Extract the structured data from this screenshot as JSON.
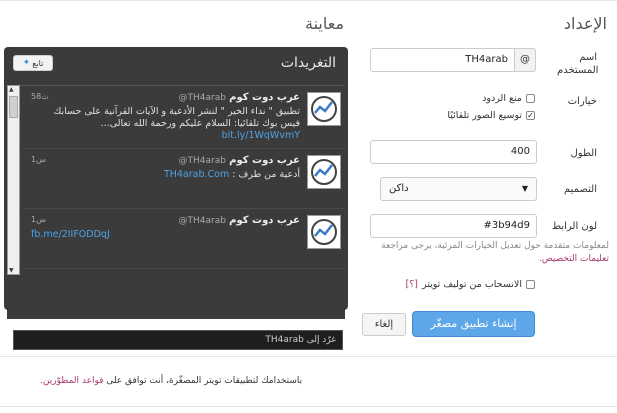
{
  "headings": {
    "settings": "الإعداد",
    "preview": "معاينة"
  },
  "form": {
    "username_label": "اسم المستخدم",
    "username_value": "TH4arab",
    "at_symbol": "@",
    "options_label": "خيارات",
    "option_no_replies": "منع الردود",
    "option_expand_photos": "توسيع الصور تلقائيًا",
    "height_label": "الطول",
    "height_value": "400",
    "theme_label": "التصميم",
    "theme_value": "داكن",
    "theme_arrow": "▼",
    "link_color_label": "لون الرابط",
    "link_color_value": "#3b94d9",
    "help_text": "لمعلومات متقدمة حول تعديل الخيارات المرئية، يرجى مراجعة",
    "help_link": "تعليمات التخصيص.",
    "opt_out_label": "الانسحاب من توليف تويتر",
    "opt_out_help": "[؟]",
    "create_button": "إنشاء تطبيق مصغّر",
    "cancel_button": "إلغاء",
    "terms_text": "باستخدامك لتطبيقات تويتر المصغّرة، أنت توافق على",
    "terms_link": "قواعد المطوّرين."
  },
  "widget": {
    "title": "التغريدات",
    "follow_label": "تابع",
    "bird_icon": "twitter-bird-icon",
    "compose_placeholder": "غرّد إلى TH4arab",
    "tweets": [
      {
        "name": "عرب دوت كوم",
        "handle": "@TH4arab",
        "time": "58ث",
        "text": "تطبيق \" نداء الخير \" لنشر الأدعية و الآيات القرآنية على حسابك فيس بوك تلقائيا: السلام عليكم ورحمة الله تعالى...",
        "link": "bit.ly/1WqWvmY"
      },
      {
        "name": "عرب دوت كوم",
        "handle": "@TH4arab",
        "time": "1س",
        "text": "أدعية من طرف :",
        "link": "TH4arab.Com"
      },
      {
        "name": "عرب دوت كوم",
        "handle": "@TH4arab",
        "time": "1س",
        "text": "",
        "link": "fb.me/2IIFODDqJ"
      }
    ]
  }
}
